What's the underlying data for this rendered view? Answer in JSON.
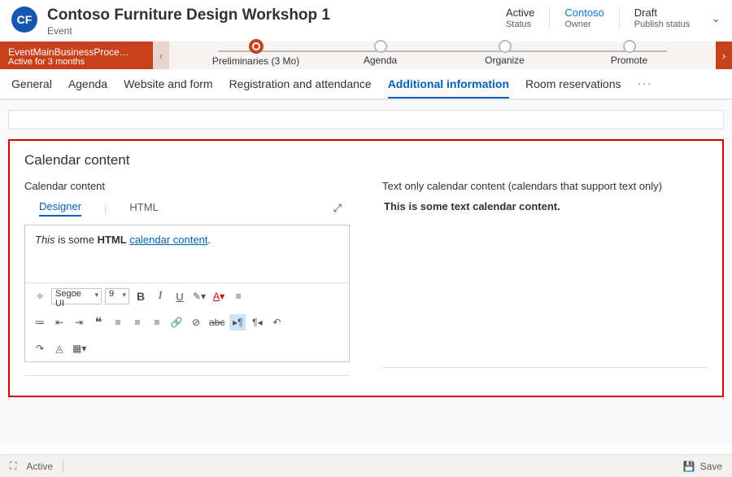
{
  "header": {
    "avatar_initials": "CF",
    "title": "Contoso Furniture Design Workshop 1",
    "subtitle": "Event",
    "meta": [
      {
        "value": "Active",
        "label": "Status",
        "link": false
      },
      {
        "value": "Contoso",
        "label": "Owner",
        "link": true
      },
      {
        "value": "Draft",
        "label": "Publish status",
        "link": false
      }
    ]
  },
  "process": {
    "name_label": "EventMainBusinessProce…",
    "duration_label": "Active for 3 months",
    "stages": [
      {
        "label": "Preliminaries  (3 Mo)",
        "active": true
      },
      {
        "label": "Agenda",
        "active": false
      },
      {
        "label": "Organize",
        "active": false
      },
      {
        "label": "Promote",
        "active": false
      }
    ]
  },
  "tabs": {
    "items": [
      "General",
      "Agenda",
      "Website and form",
      "Registration and attendance",
      "Additional information",
      "Room reservations"
    ],
    "active_index": 4,
    "more": "···"
  },
  "section": {
    "title": "Calendar content",
    "left": {
      "field_label": "Calendar content",
      "editor_tabs": {
        "designer": "Designer",
        "html": "HTML",
        "active": "designer"
      },
      "content_parts": {
        "p1": "This",
        "p2": " is some ",
        "p3": "HTML",
        "p4": " ",
        "p5": "calendar content",
        "p6": "."
      },
      "toolbar": {
        "font_family": "Segoe UI",
        "font_size": "9"
      }
    },
    "right": {
      "field_label": "Text only calendar content (calendars that support text only)",
      "text_value": "This is some text calendar content."
    }
  },
  "footer": {
    "status": "Active",
    "save_label": "Save"
  }
}
